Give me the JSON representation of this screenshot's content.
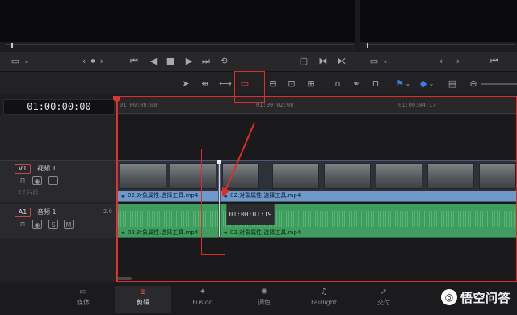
{
  "viewer": {
    "left_icons": [
      "monitor-icon",
      "chevron-down-icon"
    ],
    "transport_icons": [
      "chevron-left-icon",
      "play-reverse-icon",
      "chevron-right-icon",
      "skip-back-icon",
      "stop-icon",
      "play-icon",
      "skip-forward-icon",
      "loop-icon",
      "clip-icon",
      "mark-in-icon",
      "mark-out-icon",
      "skip-end-icon"
    ]
  },
  "toolbar": {
    "tools": [
      "selection-icon",
      "trim-icon",
      "dynamic-trim-icon",
      "blade-icon",
      "insert-icon",
      "overwrite-icon",
      "replace-icon",
      "snapping-icon",
      "linked-selection-icon",
      "lock-icon",
      "flag-icon",
      "marker-icon",
      "zoom-out-icon"
    ]
  },
  "timeline": {
    "timecode": "01:00:00:00",
    "ruler": [
      "01:00:00:00",
      "01:00:02:08",
      "01:00:04:17"
    ],
    "tracks": {
      "video": {
        "id": "V1",
        "name": "视频 1",
        "clip_count": "2个片段"
      },
      "audio": {
        "id": "A1",
        "name": "音频 1",
        "gain": "2.0",
        "solo": "S",
        "mute": "M"
      }
    },
    "clips": {
      "video_left": "02.对象属性.选择工具.mp4",
      "video_right": "02.对象属性.选择工具.mp4",
      "audio_left": "02.对象属性.选择工具.mp4",
      "audio_right": "02.对象属性.选择工具.mp4"
    },
    "tooltip": "01:00:01:19"
  },
  "pages": [
    {
      "label": "媒体",
      "icon": "media-icon"
    },
    {
      "label": "剪辑",
      "icon": "edit-icon",
      "active": true
    },
    {
      "label": "Fusion",
      "icon": "fusion-icon"
    },
    {
      "label": "调色",
      "icon": "color-icon"
    },
    {
      "label": "Fairlight",
      "icon": "fairlight-icon"
    },
    {
      "label": "交付",
      "icon": "deliver-icon"
    }
  ],
  "watermark": {
    "text": "悟空问答"
  },
  "colors": {
    "accent_red": "#e02b2b",
    "video_clip": "#6e99c9",
    "audio_clip": "#3f9d60",
    "playhead": "#d63a3a"
  }
}
